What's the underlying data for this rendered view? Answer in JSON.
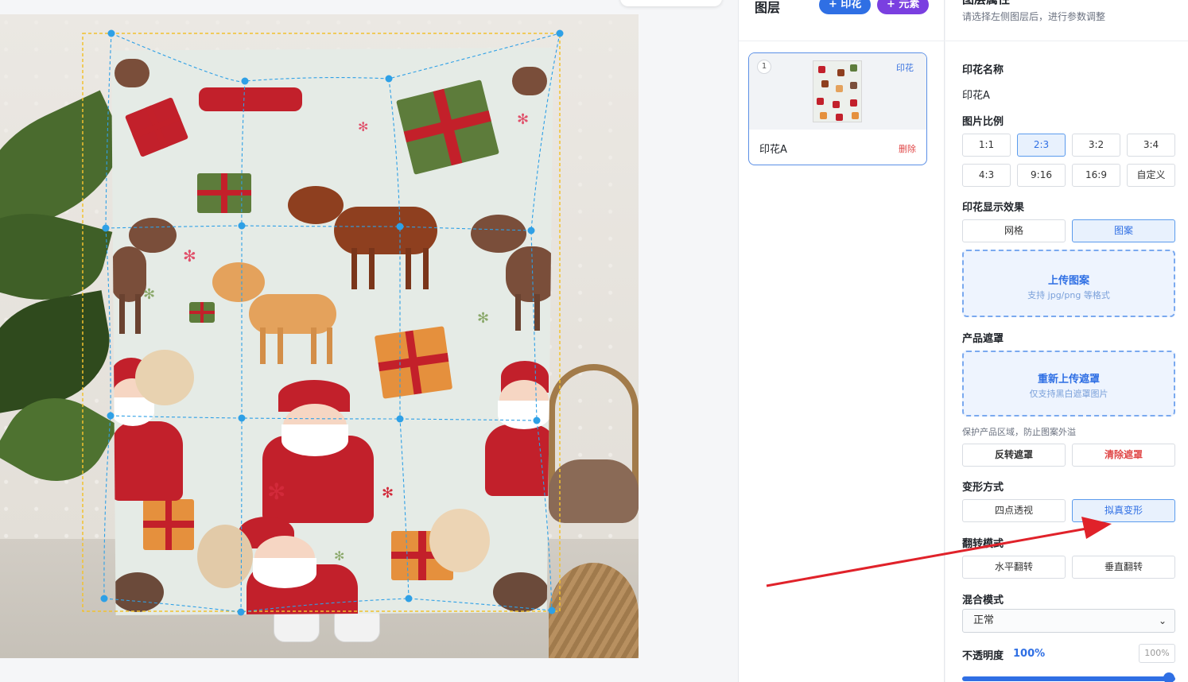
{
  "layers": {
    "title": "图层",
    "add_print_label": "+ 印花",
    "add_element_label": "+ 元素",
    "items": [
      {
        "index": "1",
        "tag": "印花",
        "name": "印花A",
        "delete_label": "删除"
      }
    ]
  },
  "properties": {
    "title": "图层属性",
    "hint": "请选择左侧图层后，进行参数调整",
    "print_name_label": "印花名称",
    "print_name_value": "印花A",
    "ratio_label": "图片比例",
    "ratios": [
      "1:1",
      "2:3",
      "3:2",
      "3:4",
      "4:3",
      "9:16",
      "16:9",
      "自定义"
    ],
    "selected_ratio": "2:3",
    "display_label": "印花显示效果",
    "display_options": [
      "网格",
      "图案"
    ],
    "selected_display": "图案",
    "upload_pattern_title": "上传图案",
    "upload_pattern_sub": "支持 jpg/png 等格式",
    "mask_label": "产品遮罩",
    "mask_upload_title": "重新上传遮罩",
    "mask_upload_sub": "仅支持黑白遮罩图片",
    "mask_note": "保护产品区域，防止图案外溢",
    "invert_mask": "反转遮罩",
    "clear_mask": "清除遮罩",
    "warp_label": "变形方式",
    "warp_options": [
      "四点透视",
      "拟真变形"
    ],
    "selected_warp": "拟真变形",
    "flip_label": "翻转模式",
    "flip_options": [
      "水平翻转",
      "垂直翻转"
    ],
    "blend_label": "混合模式",
    "blend_value": "正常",
    "opacity_label": "不透明度",
    "opacity_value": "100%",
    "opacity_input": "100%",
    "opacity_level": 1.0
  },
  "colors": {
    "accent": "#2f6fe4",
    "element_button": "#7a3fe0",
    "danger": "#e04848",
    "annotation_arrow": "#e0222a",
    "guide": "#2ea0e6",
    "bbox": "#f2c12e"
  }
}
